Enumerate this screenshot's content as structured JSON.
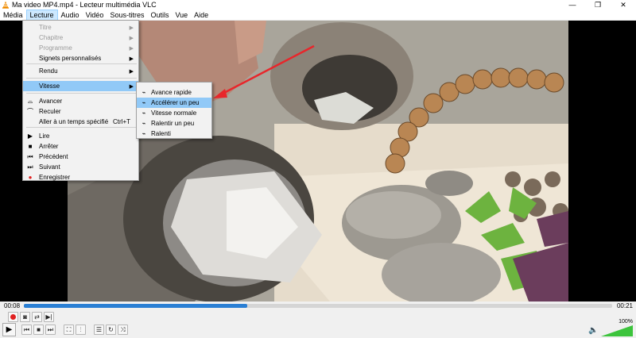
{
  "window": {
    "title": "Ma video MP4.mp4 - Lecteur multimédia VLC",
    "minimize": "—",
    "maximize": "❐",
    "close": "✕"
  },
  "menubar": {
    "items": [
      "Média",
      "Lecture",
      "Audio",
      "Vidéo",
      "Sous-titres",
      "Outils",
      "Vue",
      "Aide"
    ],
    "active": "Lecture"
  },
  "lecture_menu": {
    "items": [
      {
        "label": "Titre",
        "disabled": true,
        "submenu": true,
        "icon": ""
      },
      {
        "label": "Chapitre",
        "disabled": true,
        "submenu": true,
        "icon": ""
      },
      {
        "label": "Programme",
        "disabled": true,
        "submenu": true,
        "icon": ""
      },
      {
        "label": "Signets personnalisés",
        "disabled": false,
        "submenu": true,
        "icon": ""
      },
      {
        "label": "Rendu",
        "disabled": false,
        "submenu": true,
        "icon": ""
      },
      {
        "label": "Vitesse",
        "disabled": false,
        "submenu": true,
        "icon": "",
        "highlighted": true
      },
      {
        "label": "Avancer",
        "disabled": false,
        "submenu": false,
        "icon": "forward-icon"
      },
      {
        "label": "Reculer",
        "disabled": false,
        "submenu": false,
        "icon": "backward-icon"
      },
      {
        "label": "Aller à un temps spécifié",
        "disabled": false,
        "submenu": false,
        "icon": "",
        "shortcut": "Ctrl+T"
      },
      {
        "label": "Lire",
        "disabled": false,
        "submenu": false,
        "icon": "play-icon"
      },
      {
        "label": "Arrêter",
        "disabled": false,
        "submenu": false,
        "icon": "stop-icon"
      },
      {
        "label": "Précédent",
        "disabled": false,
        "submenu": false,
        "icon": "previous-icon"
      },
      {
        "label": "Suivant",
        "disabled": false,
        "submenu": false,
        "icon": "next-icon"
      },
      {
        "label": "Enregistrer",
        "disabled": false,
        "submenu": false,
        "icon": "record-icon"
      }
    ]
  },
  "speed_menu": {
    "items": [
      {
        "label": "Avance rapide",
        "highlighted": false
      },
      {
        "label": "Accélérer un peu",
        "highlighted": true
      },
      {
        "label": "Vitesse normale",
        "highlighted": false
      },
      {
        "label": "Ralentir un peu",
        "highlighted": false
      },
      {
        "label": "Ralenti",
        "highlighted": false
      }
    ]
  },
  "seek": {
    "elapsed": "00:08",
    "total": "00:21",
    "progress": 0.38
  },
  "volume": {
    "label": "100%",
    "level": 1.0
  },
  "colors": {
    "highlight": "#91c9f7",
    "seek_fill": "#2a7fd4",
    "record_red": "#e02020",
    "annotation_arrow": "#e8262b",
    "volume_green": "#3cc43c"
  }
}
